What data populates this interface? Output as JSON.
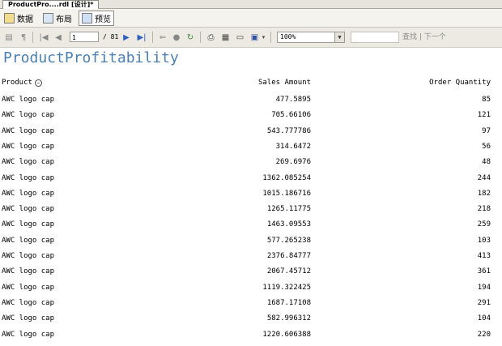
{
  "document_tab": {
    "label": "ProductPro....rdl [设计]*"
  },
  "view_tabs": [
    {
      "label": "数据",
      "icon": "data-icon"
    },
    {
      "label": "布局",
      "icon": "layout-icon"
    },
    {
      "label": "预览",
      "icon": "preview-icon"
    }
  ],
  "toolbar": {
    "page_current": "1",
    "page_total": "/ 81",
    "zoom": "100%",
    "find_label": "查找",
    "find_next_label": "下一个"
  },
  "report": {
    "title": "ProductProfitability",
    "columns": [
      "Product",
      "Sales Amount",
      "Order Quantity"
    ],
    "rows": [
      {
        "product": "AWC logo cap",
        "sales": "477.5895",
        "qty": "85"
      },
      {
        "product": "AWC logo cap",
        "sales": "705.66106",
        "qty": "121"
      },
      {
        "product": "AWC logo cap",
        "sales": "543.777786",
        "qty": "97"
      },
      {
        "product": "AWC logo cap",
        "sales": "314.6472",
        "qty": "56"
      },
      {
        "product": "AWC logo cap",
        "sales": "269.6976",
        "qty": "48"
      },
      {
        "product": "AWC logo cap",
        "sales": "1362.085254",
        "qty": "244"
      },
      {
        "product": "AWC logo cap",
        "sales": "1015.186716",
        "qty": "182"
      },
      {
        "product": "AWC logo cap",
        "sales": "1265.11775",
        "qty": "218"
      },
      {
        "product": "AWC logo cap",
        "sales": "1463.09553",
        "qty": "259"
      },
      {
        "product": "AWC logo cap",
        "sales": "577.265238",
        "qty": "103"
      },
      {
        "product": "AWC logo cap",
        "sales": "2376.84777",
        "qty": "413"
      },
      {
        "product": "AWC logo cap",
        "sales": "2067.45712",
        "qty": "361"
      },
      {
        "product": "AWC logo cap",
        "sales": "1119.322425",
        "qty": "194"
      },
      {
        "product": "AWC logo cap",
        "sales": "1687.17108",
        "qty": "291"
      },
      {
        "product": "AWC logo cap",
        "sales": "582.996312",
        "qty": "104"
      },
      {
        "product": "AWC logo cap",
        "sales": "1220.606388",
        "qty": "220"
      }
    ]
  },
  "colors": {
    "title": "#4a7fb0",
    "nav_arrow": "#2f5fbf"
  }
}
